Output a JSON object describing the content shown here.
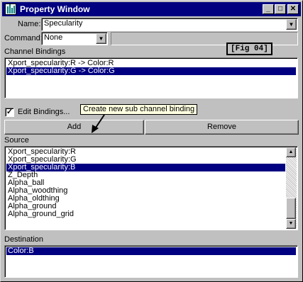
{
  "window": {
    "title": "Property Window"
  },
  "name_field": {
    "label": "Name:",
    "value": "Specularity"
  },
  "command_field": {
    "label": "Command:",
    "value": "None"
  },
  "figure_tag": "[Fig 04]",
  "channel_bindings": {
    "label": "Channel Bindings",
    "items": [
      "Xport_specularity:R -> Color:R",
      "Xport_specularity:G -> Color:G"
    ],
    "selected_index": 1
  },
  "edit_bindings": {
    "label": "Edit Bindings...",
    "checked": true
  },
  "tooltip": "Create new sub channel binding",
  "buttons": {
    "add": "Add",
    "remove": "Remove"
  },
  "source": {
    "label": "Source",
    "items": [
      "Xport_specularity:R",
      "Xport_specularity:G",
      "Xport_specularity:B",
      "Z_Depth",
      "Alpha_ball",
      "Alpha_woodthing",
      "Alpha_oldthing",
      "Alpha_ground",
      "Alpha_ground_grid"
    ],
    "selected_index": 2
  },
  "destination": {
    "label": "Destination",
    "items": [
      "Color:B"
    ],
    "selected_index": 0
  },
  "colors": {
    "titlebar": "#000080",
    "selection": "#000080",
    "face": "#c0c0c0",
    "tooltip": "#ffffe1"
  }
}
